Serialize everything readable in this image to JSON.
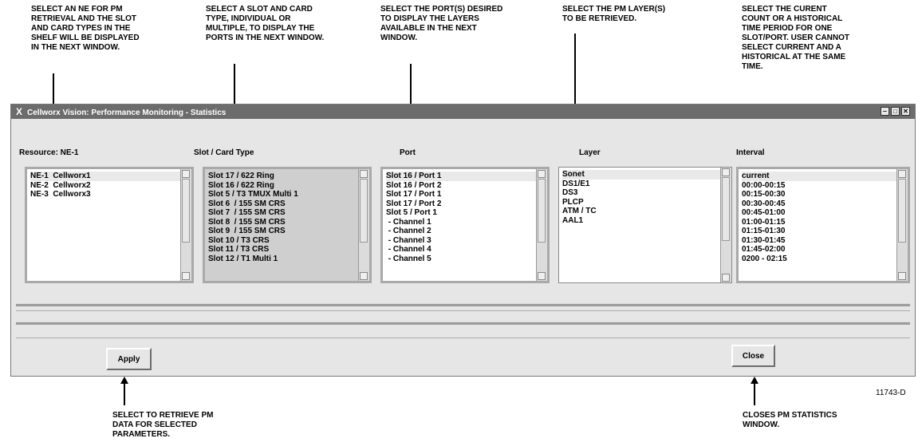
{
  "callouts": {
    "ne": "SELECT AN NE FOR PM\nRETRIEVAL AND THE SLOT\nAND  CARD TYPES IN THE\nSHELF WILL BE DISPLAYED\nIN THE NEXT WINDOW.",
    "slot": "SELECT A SLOT AND CARD\nTYPE, INDIVIDUAL OR\nMULTIPLE, TO DISPLAY THE\nPORTS IN THE NEXT WINDOW.",
    "port": "SELECT THE PORT(S) DESIRED\nTO DISPLAY THE LAYERS\nAVAILABLE IN THE NEXT\nWINDOW.",
    "layer": "SELECT THE PM LAYER(S)\nTO BE RETRIEVED.",
    "interval": "SELECT THE CURENT\nCOUNT OR A HISTORICAL\nTIME PERIOD FOR ONE\nSLOT/PORT. USER CANNOT\nSELECT CURRENT AND A\nHISTORICAL AT THE SAME\nTIME.",
    "apply": "SELECT TO RETRIEVE PM\nDATA FOR SELECTED\nPARAMETERS.",
    "close": "CLOSES PM STATISTICS\nWINDOW."
  },
  "window": {
    "title": "Cellworx Vision: Performance Monitoring - Statistics",
    "title_glyph": "X"
  },
  "columns": {
    "resource": "Resource:  NE-1",
    "slot": "Slot / Card Type",
    "port": "Port",
    "layer": "Layer",
    "interval": "Interval"
  },
  "lists": {
    "resource": [
      "NE-1  Cellworx1",
      "NE-2  Cellworx2",
      "NE-3  Cellworx3"
    ],
    "slot": [
      "Slot 17 / 622 Ring",
      "Slot 16 / 622 Ring",
      "Slot 5 / T3 TMUX Multi 1",
      "Slot 6  / 155 SM CRS",
      "Slot 7  / 155 SM CRS",
      "Slot 8  / 155 SM CRS",
      "Slot 9  / 155 SM CRS",
      "Slot 10 / T3 CRS",
      "Slot 11 / T3 CRS",
      "Slot 12 / T1 Multi 1"
    ],
    "port": [
      "Slot 16 / Port 1",
      "Slot 16 / Port 2",
      "Slot 17 / Port 1",
      "Slot 17 / Port 2",
      "Slot 5 / Port 1",
      " - Channel 1",
      " - Channel 2",
      " - Channel 3",
      " - Channel 4",
      " - Channel 5"
    ],
    "layer": [
      "Sonet",
      "DS1/E1",
      "DS3",
      "PLCP",
      "ATM / TC",
      "AAL1"
    ],
    "interval": [
      "current",
      "00:00-00:15",
      "00:15-00:30",
      "00:30-00:45",
      "00:45-01:00",
      "01:00-01:15",
      "01:15-01:30",
      "01:30-01:45",
      "01:45-02:00",
      "0200 - 02:15"
    ]
  },
  "buttons": {
    "apply": "Apply",
    "close": "Close"
  },
  "figure_number": "11743-D"
}
